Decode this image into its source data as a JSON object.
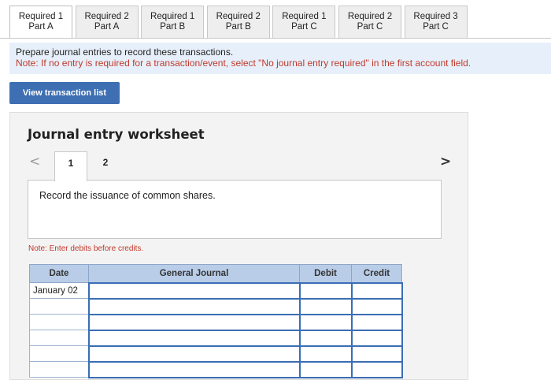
{
  "tabs": [
    {
      "line1": "Required 1",
      "line2": "Part A",
      "active": true
    },
    {
      "line1": "Required 2",
      "line2": "Part A",
      "active": false
    },
    {
      "line1": "Required 1",
      "line2": "Part B",
      "active": false
    },
    {
      "line1": "Required 2",
      "line2": "Part B",
      "active": false
    },
    {
      "line1": "Required 1",
      "line2": "Part C",
      "active": false
    },
    {
      "line1": "Required 2",
      "line2": "Part C",
      "active": false
    },
    {
      "line1": "Required 3",
      "line2": "Part C",
      "active": false
    }
  ],
  "instructions": {
    "main": "Prepare journal entries to record these transactions.",
    "note": "Note: If no entry is required for a transaction/event, select \"No journal entry required\" in the first account field."
  },
  "view_button": "View transaction list",
  "worksheet": {
    "title": "Journal entry worksheet",
    "prev_icon": "<",
    "next_icon": ">",
    "pages": [
      "1",
      "2"
    ],
    "description": "Record the issuance of common shares.",
    "note": "Note: Enter debits before credits.",
    "columns": {
      "date": "Date",
      "journal": "General Journal",
      "debit": "Debit",
      "credit": "Credit"
    },
    "rows": [
      {
        "date": "January 02"
      },
      {
        "date": ""
      },
      {
        "date": ""
      },
      {
        "date": ""
      },
      {
        "date": ""
      },
      {
        "date": ""
      }
    ]
  }
}
